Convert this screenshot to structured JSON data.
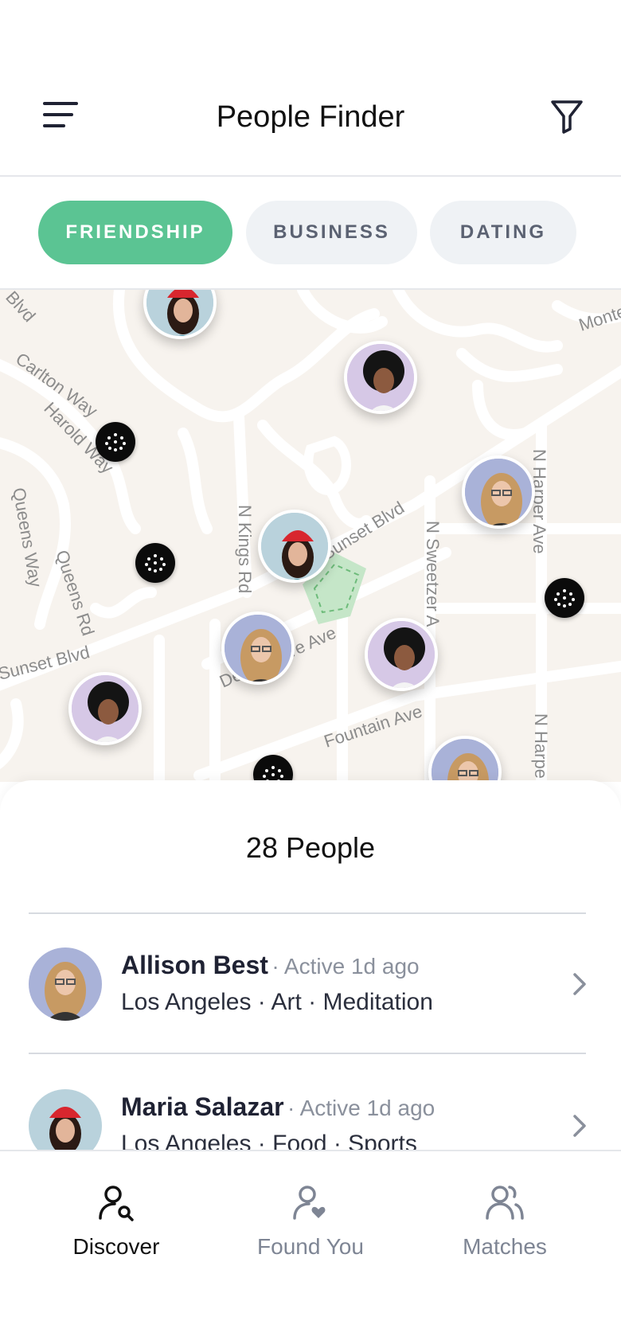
{
  "header": {
    "title": "People Finder"
  },
  "tabs": [
    {
      "label": "FRIENDSHIP",
      "active": true
    },
    {
      "label": "BUSINESS",
      "active": false
    },
    {
      "label": "DATING",
      "active": false
    }
  ],
  "map": {
    "street_labels": [
      "Blvd",
      "Carlton Way",
      "Harold Way",
      "Queens Way",
      "Queens Rd",
      "N Kings Rd",
      "Sunset Blvd",
      "Sunset Blvd",
      "De Longpre Ave",
      "N Sweetzer A",
      "N Harper Ave",
      "N Harpe",
      "Fountain Ave",
      "Monte"
    ]
  },
  "list": {
    "count_label": "28 People",
    "people": [
      {
        "name": "Allison Best",
        "active": "· Active 1d ago",
        "details": "Los Angeles · Art · Meditation"
      },
      {
        "name": "Maria Salazar",
        "active": "· Active 1d ago",
        "details": "Los Angeles · Food · Sports"
      }
    ]
  },
  "nav": [
    {
      "label": "Discover",
      "icon": "discover-icon",
      "active": true
    },
    {
      "label": "Found You",
      "icon": "found-you-icon",
      "active": false
    },
    {
      "label": "Matches",
      "icon": "matches-icon",
      "active": false
    }
  ],
  "colors": {
    "accent": "#5bc493",
    "map_bg": "#f7f3ee",
    "park": "#c5e6c8"
  }
}
